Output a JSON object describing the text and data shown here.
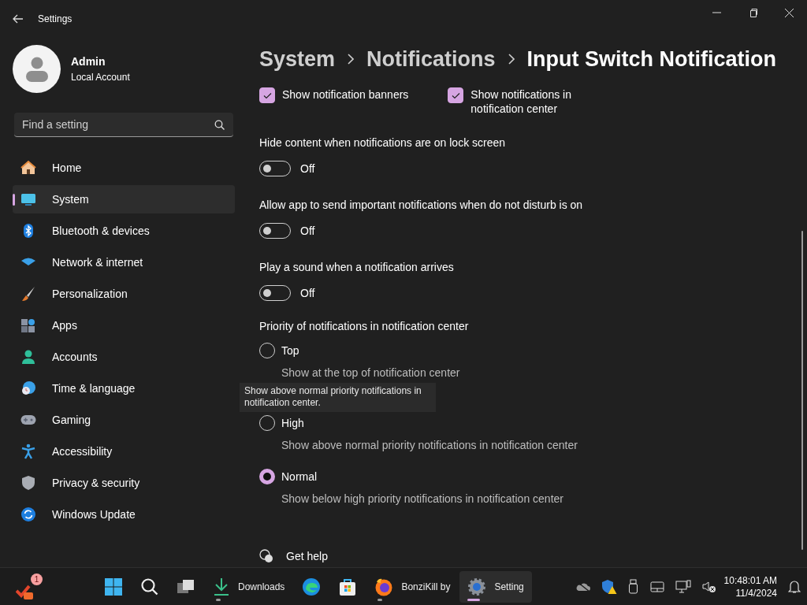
{
  "window": {
    "title": "Settings"
  },
  "user": {
    "name": "Admin",
    "account": "Local Account"
  },
  "search": {
    "placeholder": "Find a setting"
  },
  "nav": [
    {
      "label": "Home",
      "selected": false
    },
    {
      "label": "System",
      "selected": true
    },
    {
      "label": "Bluetooth & devices",
      "selected": false
    },
    {
      "label": "Network & internet",
      "selected": false
    },
    {
      "label": "Personalization",
      "selected": false
    },
    {
      "label": "Apps",
      "selected": false
    },
    {
      "label": "Accounts",
      "selected": false
    },
    {
      "label": "Time & language",
      "selected": false
    },
    {
      "label": "Gaming",
      "selected": false
    },
    {
      "label": "Accessibility",
      "selected": false
    },
    {
      "label": "Privacy & security",
      "selected": false
    },
    {
      "label": "Windows Update",
      "selected": false
    }
  ],
  "breadcrumb": [
    "System",
    "Notifications",
    "Input Switch Notification"
  ],
  "checkboxes": [
    {
      "label": "Show notification banners",
      "checked": true
    },
    {
      "label": "Show notifications in notification center",
      "checked": true
    }
  ],
  "toggles": [
    {
      "label": "Hide content when notifications are on lock screen",
      "on": false,
      "state_text": "Off"
    },
    {
      "label": "Allow app to send important notifications when do not disturb is on",
      "on": false,
      "state_text": "Off"
    },
    {
      "label": "Play a sound when a notification arrives",
      "on": false,
      "state_text": "Off"
    }
  ],
  "priority": {
    "label": "Priority of notifications in notification center",
    "options": [
      {
        "label": "Top",
        "description": "Show at the top of notification center",
        "selected": false
      },
      {
        "label": "High",
        "description": "Show above normal priority notifications in notification center",
        "selected": false
      },
      {
        "label": "Normal",
        "description": "Show below high priority notifications in notification center",
        "selected": true
      }
    ]
  },
  "tooltip": {
    "text": "Show above normal priority notifications in notification center."
  },
  "help": {
    "label": "Get help"
  },
  "taskbar": {
    "widget_badge": "1",
    "apps": [
      {
        "running": false,
        "active": false
      },
      {
        "running": false,
        "active": false
      },
      {
        "running": false,
        "active": false
      },
      {
        "label": "Downloads",
        "running": true,
        "active": false
      },
      {
        "running": false,
        "active": false
      },
      {
        "running": false,
        "active": false
      },
      {
        "label": "BonziKill by",
        "running": true,
        "active": false
      },
      {
        "label": "Setting",
        "running": true,
        "active": true
      }
    ],
    "time": "10:48:01 AM",
    "date": "11/4/2024"
  }
}
